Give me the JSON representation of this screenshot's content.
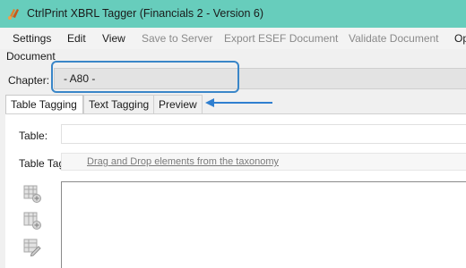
{
  "app": {
    "title": "CtrlPrint XBRL Tagger (Financials 2 - Version 6)",
    "icon": "ctrlprint-logo-icon"
  },
  "menu": {
    "items": [
      {
        "label": "Settings",
        "enabled": true
      },
      {
        "label": "Edit",
        "enabled": true
      },
      {
        "label": "View",
        "enabled": true
      },
      {
        "label": "Save to Server",
        "enabled": false
      },
      {
        "label": "Export ESEF Document",
        "enabled": false
      },
      {
        "label": "Validate Document",
        "enabled": false
      },
      {
        "label": "Op",
        "enabled": true
      }
    ]
  },
  "document": {
    "label": "Document"
  },
  "chapter": {
    "label": "Chapter:",
    "value": "- A80 -"
  },
  "tabs": [
    {
      "label": "Table Tagging",
      "active": true
    },
    {
      "label": "Text Tagging",
      "active": false
    },
    {
      "label": "Preview",
      "active": false
    }
  ],
  "table_tagging": {
    "table_label": "Table:",
    "table_value": "",
    "table_tag_label": "Table Tag:",
    "table_tag_placeholder": "Drag and Drop elements from the taxonomy"
  },
  "colors": {
    "titlebar": "#67cdbc",
    "highlight": "#3a86c8",
    "arrow": "#2f7fd0"
  },
  "tools": [
    "add-table-icon",
    "insert-column-icon",
    "edit-table-icon"
  ]
}
